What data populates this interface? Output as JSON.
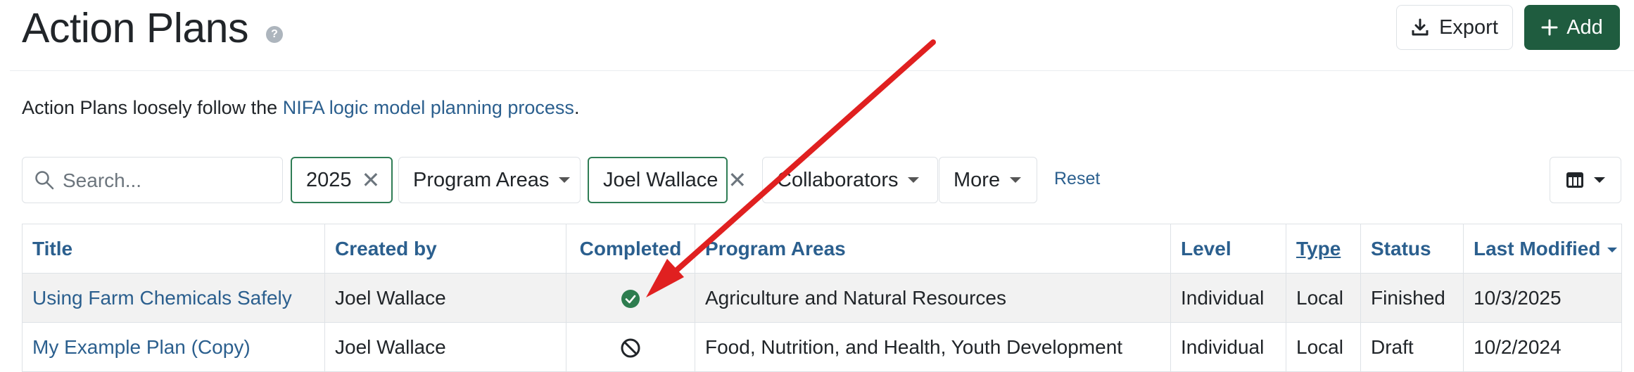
{
  "header": {
    "title": "Action Plans",
    "help_glyph": "?",
    "export_label": "Export",
    "add_label": "Add"
  },
  "intro": {
    "text_before": "Action Plans loosely follow the ",
    "link_text": "NIFA logic model planning process",
    "text_after": "."
  },
  "filters": {
    "search_placeholder": "Search...",
    "year_value": "2025",
    "program_areas_label": "Program Areas",
    "creator_value": "Joel Wallace",
    "collaborators_label": "Collaborators",
    "more_label": "More",
    "reset_label": "Reset"
  },
  "table": {
    "columns": [
      "Title",
      "Created by",
      "Completed",
      "Program Areas",
      "Level",
      "Type",
      "Status",
      "Last Modified"
    ],
    "rows": [
      {
        "title": "Using Farm Chemicals Safely",
        "created_by": "Joel Wallace",
        "completed": "check-circle-icon",
        "program_areas": "Agriculture and Natural Resources",
        "level": "Individual",
        "type": "Local",
        "status": "Finished",
        "last_modified": "10/3/2025"
      },
      {
        "title": "My Example Plan (Copy)",
        "created_by": "Joel Wallace",
        "completed": "not-allowed-icon",
        "program_areas": "Food, Nutrition, and Health, Youth Development",
        "level": "Individual",
        "type": "Local",
        "status": "Draft",
        "last_modified": "10/2/2024"
      }
    ]
  },
  "colors": {
    "link": "#2b5f8e",
    "add_button": "#1f5c3f",
    "active_filter_border": "#2f7d55",
    "check_green": "#2e7d4f",
    "annotation_arrow": "#e02020"
  }
}
